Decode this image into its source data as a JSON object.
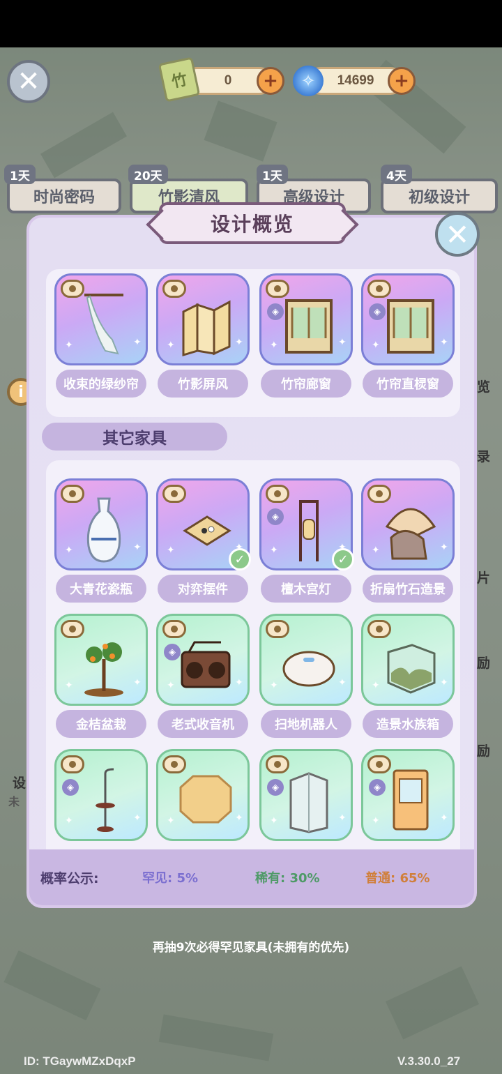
{
  "currency": {
    "tickets": "0",
    "gems": "14699"
  },
  "tabs": [
    {
      "days": "1天",
      "label": "时尚密码"
    },
    {
      "days": "20天",
      "label": "竹影清风"
    },
    {
      "days": "1天",
      "label": "高级设计"
    },
    {
      "days": "4天",
      "label": "初级设计"
    }
  ],
  "side": {
    "right_texts": [
      "览",
      "录",
      "片",
      "励",
      "励"
    ],
    "left_texts": [
      "设",
      "未"
    ]
  },
  "panel": {
    "title": "设计概览",
    "section_other": "其它家具",
    "top_items": [
      {
        "name": "收束的绿纱帘",
        "rarity": "rare",
        "icon": "curtain-icon"
      },
      {
        "name": "竹影屏风",
        "rarity": "rare",
        "icon": "screen-icon"
      },
      {
        "name": "竹帘廊窗",
        "rarity": "rare",
        "icon": "window-icon"
      },
      {
        "name": "竹帘直棂窗",
        "rarity": "rare",
        "icon": "window-icon"
      }
    ],
    "other_items": [
      {
        "name": "大青花瓷瓶",
        "rarity": "rare",
        "icon": "vase-icon"
      },
      {
        "name": "对弈摆件",
        "rarity": "rare",
        "icon": "go-board-icon",
        "owned": true
      },
      {
        "name": "檀木宫灯",
        "rarity": "rare",
        "icon": "lamp-icon",
        "owned": true
      },
      {
        "name": "折扇竹石造景",
        "rarity": "rare",
        "icon": "fan-rock-icon"
      },
      {
        "name": "金桔盆栽",
        "rarity": "uncommon",
        "icon": "bonsai-icon"
      },
      {
        "name": "老式收音机",
        "rarity": "uncommon",
        "icon": "radio-icon"
      },
      {
        "name": "扫地机器人",
        "rarity": "uncommon",
        "icon": "robot-vacuum-icon"
      },
      {
        "name": "造景水族箱",
        "rarity": "uncommon",
        "icon": "aquarium-icon"
      },
      {
        "name": "",
        "rarity": "uncommon",
        "icon": "floor-lamp-icon"
      },
      {
        "name": "",
        "rarity": "uncommon",
        "icon": "rug-icon"
      },
      {
        "name": "",
        "rarity": "uncommon",
        "icon": "shower-icon"
      },
      {
        "name": "",
        "rarity": "uncommon",
        "icon": "claw-machine-icon"
      }
    ],
    "probability": {
      "title": "概率公示:",
      "rare": "罕见: 5%",
      "uncommon": "稀有: 30%",
      "common": "普通: 65%",
      "colors": {
        "rare": "#7b6fd0",
        "uncommon": "#4e9a67",
        "common": "#d07f3a"
      }
    }
  },
  "hint": "再抽9次必得罕见家具(未拥有的优先)",
  "footer": {
    "id": "ID: TGaywMZxDqxP",
    "version": "V.3.30.0_27"
  }
}
